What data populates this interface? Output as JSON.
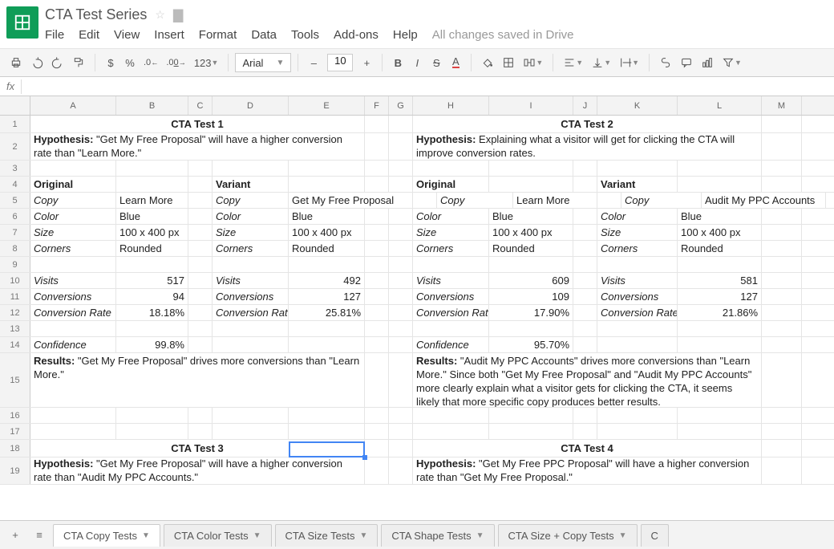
{
  "doc": {
    "title": "CTA Test Series"
  },
  "menu": {
    "file": "File",
    "edit": "Edit",
    "view": "View",
    "insert": "Insert",
    "format": "Format",
    "data": "Data",
    "tools": "Tools",
    "addons": "Add-ons",
    "help": "Help",
    "drive": "All changes saved in Drive"
  },
  "toolbar": {
    "dollar": "$",
    "percent": "%",
    "dec_dec": ".0←",
    "dec_inc": ".00→",
    "numfmt": "123",
    "font": "Arial",
    "size": "10",
    "bold": "B",
    "italic": "I",
    "strike": "S",
    "textcolor": "A"
  },
  "fx": {
    "label": "fx"
  },
  "columns": [
    "A",
    "B",
    "C",
    "D",
    "E",
    "F",
    "G",
    "H",
    "I",
    "J",
    "K",
    "L",
    "M"
  ],
  "rownums": [
    "1",
    "2",
    "3",
    "4",
    "5",
    "6",
    "7",
    "8",
    "9",
    "10",
    "11",
    "12",
    "13",
    "14",
    "15",
    "16",
    "17",
    "18",
    "19"
  ],
  "labels": {
    "hypothesis": "Hypothesis:",
    "results": "Results:",
    "original": "Original",
    "variant": "Variant",
    "copy": "Copy",
    "color": "Color",
    "size": "Size",
    "corners": "Corners",
    "visits": "Visits",
    "conversions": "Conversions",
    "crate": "Conversion Rate",
    "confidence": "Confidence"
  },
  "tests": {
    "t1": {
      "title": "CTA Test 1",
      "hypothesis": "\"Get My Free Proposal\" will have a higher conversion rate than \"Learn More.\"",
      "original": {
        "copy": "Learn More",
        "color": "Blue",
        "size": "100 x 400 px",
        "corners": "Rounded",
        "visits": "517",
        "conversions": "94",
        "crate": "18.18%"
      },
      "variant": {
        "copy": "Get My Free Proposal",
        "color": "Blue",
        "size": "100 x 400 px",
        "corners": "Rounded",
        "visits": "492",
        "conversions": "127",
        "crate": "25.81%"
      },
      "confidence": "99.8%",
      "results": "\"Get My Free Proposal\" drives more conversions than \"Learn More.\""
    },
    "t2": {
      "title": "CTA Test 2",
      "hypothesis": "Explaining what a visitor will get for clicking the CTA will improve conversion rates.",
      "original": {
        "copy": "Learn More",
        "color": "Blue",
        "size": "100 x 400 px",
        "corners": "Rounded",
        "visits": "609",
        "conversions": "109",
        "crate": "17.90%"
      },
      "variant": {
        "copy": "Audit My PPC Accounts",
        "color": "Blue",
        "size": "100 x 400 px",
        "corners": "Rounded",
        "visits": "581",
        "conversions": "127",
        "crate": "21.86%"
      },
      "confidence": "95.70%",
      "results": "\"Audit My PPC Accounts\" drives more conversions than \"Learn More.\" Since both \"Get My Free Proposal\" and \"Audit My PPC Accounts\" more clearly explain what a visitor gets for clicking the CTA, it seems likely that more specific copy produces better results."
    },
    "t3": {
      "title": "CTA Test 3",
      "hypothesis": "\"Get My Free Proposal\" will have a higher conversion rate than \"Audit My PPC Accounts.\""
    },
    "t4": {
      "title": "CTA Test 4",
      "hypothesis": "\"Get My Free PPC Proposal\" will have a higher conversion rate than \"Get My Free Proposal.\""
    }
  },
  "tabs": {
    "t0": "CTA Copy Tests",
    "t1": "CTA Color Tests",
    "t2": "CTA Size Tests",
    "t3": "CTA Shape Tests",
    "t4": "CTA Size + Copy Tests",
    "t5": "C"
  }
}
